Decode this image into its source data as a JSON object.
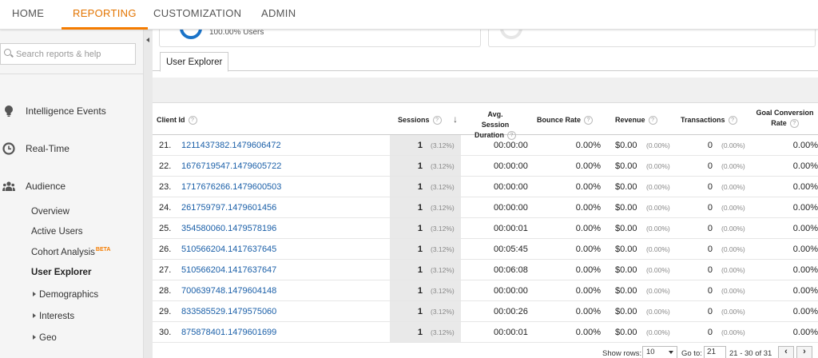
{
  "nav": {
    "tabs": [
      {
        "label": "HOME",
        "active": false
      },
      {
        "label": "REPORTING",
        "active": true
      },
      {
        "label": "CUSTOMIZATION",
        "active": false
      },
      {
        "label": "ADMIN",
        "active": false
      }
    ]
  },
  "sidebar": {
    "search_placeholder": "Search reports & help",
    "sections": [
      {
        "icon": "lightbulb-icon",
        "label": "Intelligence Events"
      },
      {
        "icon": "clock-icon",
        "label": "Real-Time"
      },
      {
        "icon": "people-icon",
        "label": "Audience"
      }
    ],
    "audience_items": [
      "Overview",
      "Active Users",
      "Cohort Analysis",
      "User Explorer",
      "Demographics",
      "Interests",
      "Geo"
    ],
    "beta_badge": "BETA"
  },
  "summary": {
    "users_percent": "100.00% Users"
  },
  "tab": "User Explorer",
  "table": {
    "headers": {
      "client_id": "Client Id",
      "sessions": "Sessions",
      "avg_duration_line1": "Avg. Session",
      "avg_duration_line2": "Duration",
      "bounce_rate": "Bounce Rate",
      "revenue": "Revenue",
      "transactions": "Transactions",
      "goal_line1": "Goal Conversion",
      "goal_line2": "Rate"
    },
    "rows": [
      {
        "n": "21.",
        "id": "1211437382.1479606472",
        "sessions": "1",
        "sess_pct": "(3.12%)",
        "duration": "00:00:00",
        "bounce": "0.00%",
        "revenue": "$0.00",
        "rev_pct": "(0.00%)",
        "trans": "0",
        "trans_pct": "(0.00%)",
        "goal": "0.00%"
      },
      {
        "n": "22.",
        "id": "1676719547.1479605722",
        "sessions": "1",
        "sess_pct": "(3.12%)",
        "duration": "00:00:00",
        "bounce": "0.00%",
        "revenue": "$0.00",
        "rev_pct": "(0.00%)",
        "trans": "0",
        "trans_pct": "(0.00%)",
        "goal": "0.00%"
      },
      {
        "n": "23.",
        "id": "1717676266.1479600503",
        "sessions": "1",
        "sess_pct": "(3.12%)",
        "duration": "00:00:00",
        "bounce": "0.00%",
        "revenue": "$0.00",
        "rev_pct": "(0.00%)",
        "trans": "0",
        "trans_pct": "(0.00%)",
        "goal": "0.00%"
      },
      {
        "n": "24.",
        "id": "261759797.1479601456",
        "sessions": "1",
        "sess_pct": "(3.12%)",
        "duration": "00:00:00",
        "bounce": "0.00%",
        "revenue": "$0.00",
        "rev_pct": "(0.00%)",
        "trans": "0",
        "trans_pct": "(0.00%)",
        "goal": "0.00%"
      },
      {
        "n": "25.",
        "id": "354580060.1479578196",
        "sessions": "1",
        "sess_pct": "(3.12%)",
        "duration": "00:00:01",
        "bounce": "0.00%",
        "revenue": "$0.00",
        "rev_pct": "(0.00%)",
        "trans": "0",
        "trans_pct": "(0.00%)",
        "goal": "0.00%"
      },
      {
        "n": "26.",
        "id": "510566204.1417637645",
        "sessions": "1",
        "sess_pct": "(3.12%)",
        "duration": "00:05:45",
        "bounce": "0.00%",
        "revenue": "$0.00",
        "rev_pct": "(0.00%)",
        "trans": "0",
        "trans_pct": "(0.00%)",
        "goal": "0.00%"
      },
      {
        "n": "27.",
        "id": "510566204.1417637647",
        "sessions": "1",
        "sess_pct": "(3.12%)",
        "duration": "00:06:08",
        "bounce": "0.00%",
        "revenue": "$0.00",
        "rev_pct": "(0.00%)",
        "trans": "0",
        "trans_pct": "(0.00%)",
        "goal": "0.00%"
      },
      {
        "n": "28.",
        "id": "700639748.1479604148",
        "sessions": "1",
        "sess_pct": "(3.12%)",
        "duration": "00:00:00",
        "bounce": "0.00%",
        "revenue": "$0.00",
        "rev_pct": "(0.00%)",
        "trans": "0",
        "trans_pct": "(0.00%)",
        "goal": "0.00%"
      },
      {
        "n": "29.",
        "id": "833585529.1479575060",
        "sessions": "1",
        "sess_pct": "(3.12%)",
        "duration": "00:00:26",
        "bounce": "0.00%",
        "revenue": "$0.00",
        "rev_pct": "(0.00%)",
        "trans": "0",
        "trans_pct": "(0.00%)",
        "goal": "0.00%"
      },
      {
        "n": "30.",
        "id": "875878401.1479601699",
        "sessions": "1",
        "sess_pct": "(3.12%)",
        "duration": "00:00:01",
        "bounce": "0.00%",
        "revenue": "$0.00",
        "rev_pct": "(0.00%)",
        "trans": "0",
        "trans_pct": "(0.00%)",
        "goal": "0.00%"
      }
    ]
  },
  "footer": {
    "show_rows_label": "Show rows:",
    "rows_value": "10",
    "goto_label": "Go to:",
    "goto_value": "21",
    "range": "21 - 30 of 31",
    "prev_label": "‹",
    "next_label": "›"
  },
  "colors": {
    "accent": "#f57c00",
    "link": "#1a5fa8",
    "donut": "#1a73c8"
  }
}
